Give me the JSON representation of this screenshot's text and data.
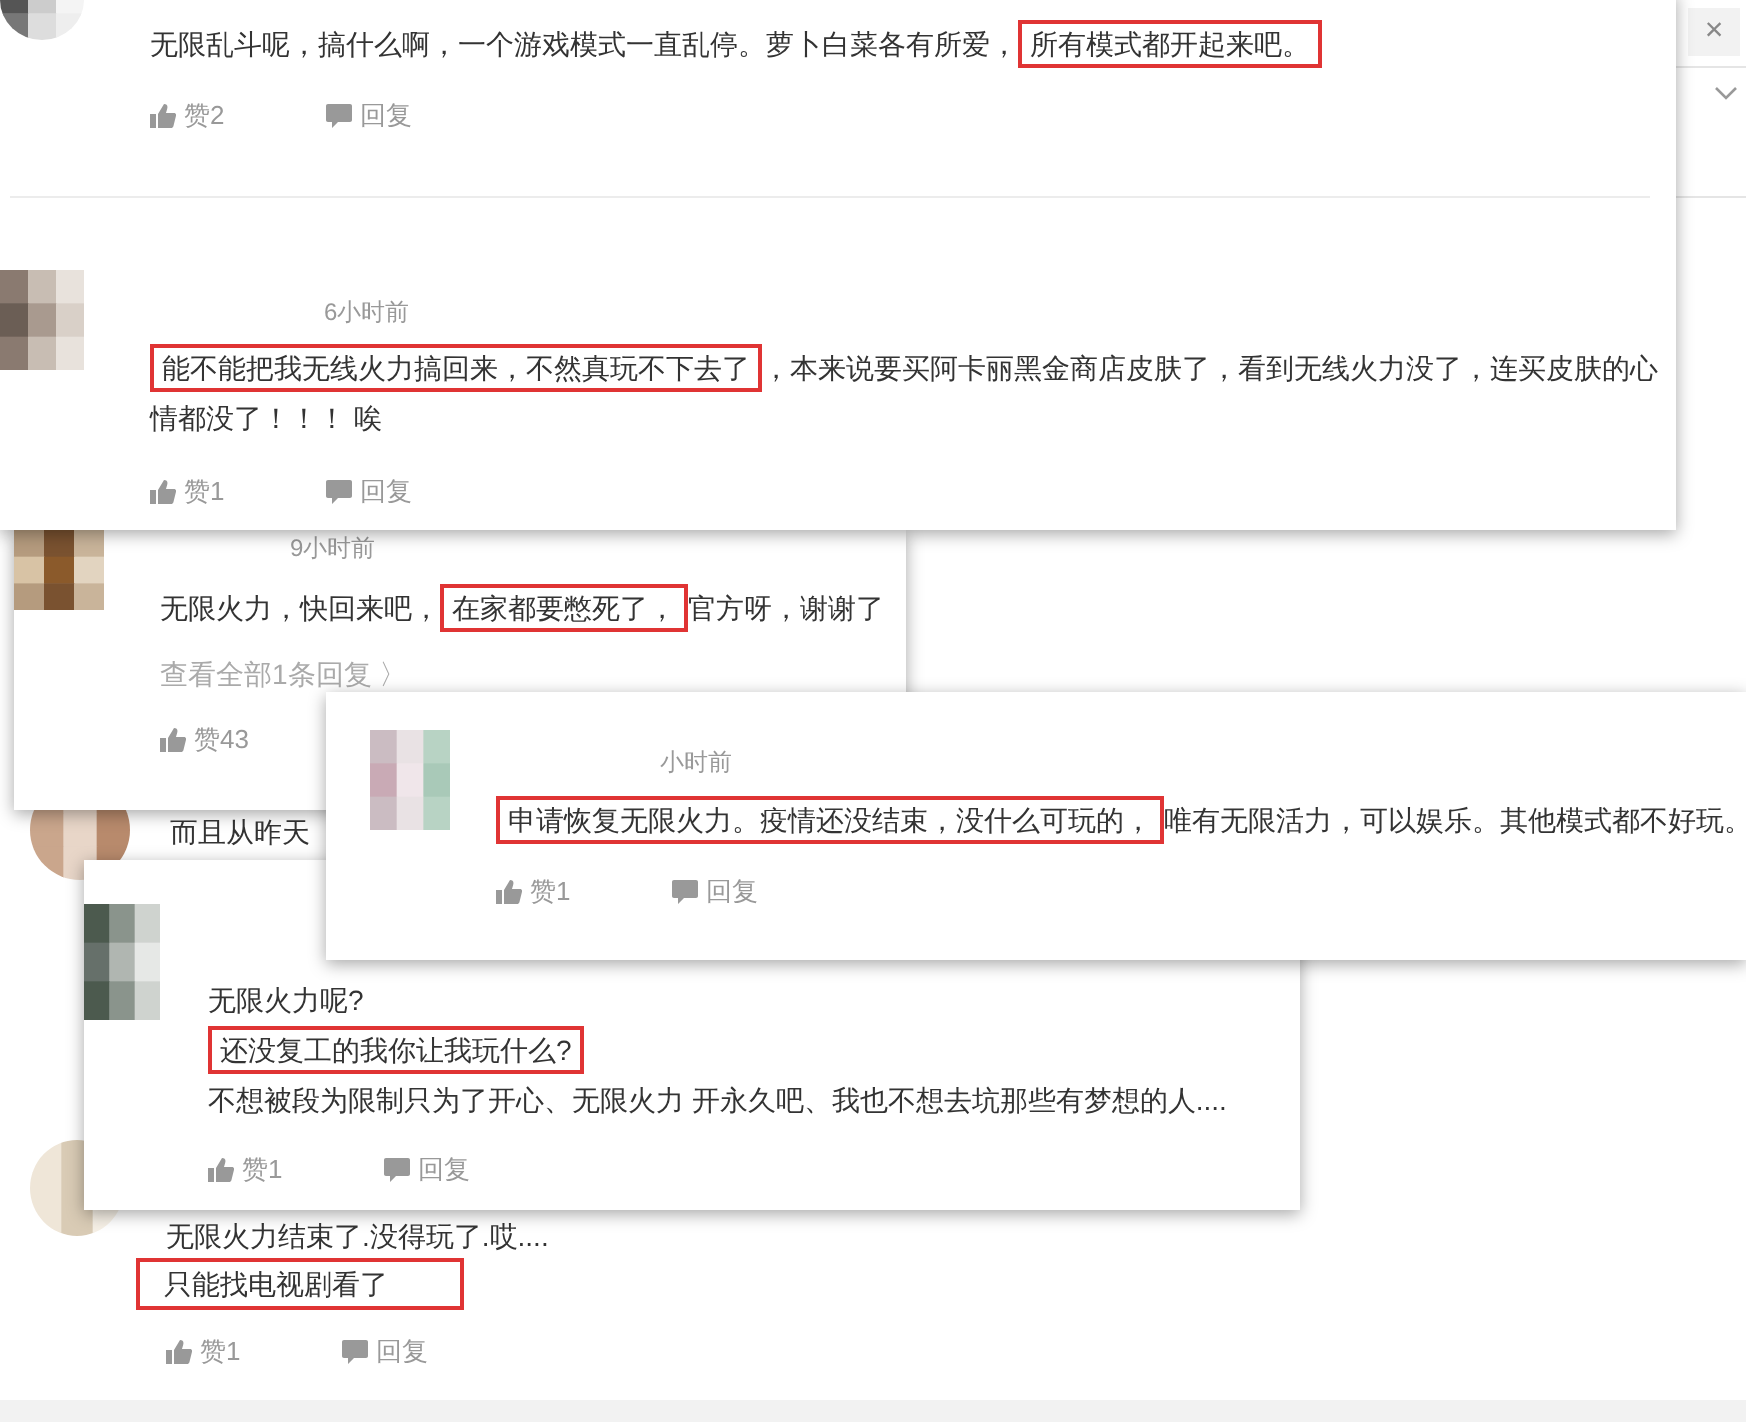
{
  "close_glyph": "×",
  "comments": [
    {
      "lines": [
        [
          {
            "text": "无限乱斗呢，搞什么啊，一个游戏模式一直乱停。萝卜白菜各有所爱，",
            "highlight": false
          },
          {
            "text": "所有模式都开起来吧。",
            "highlight": true
          }
        ]
      ],
      "likes": "赞2",
      "reply": "回复"
    },
    {
      "time": "6小时前",
      "lines": [
        [
          {
            "text": "能不能把我无线火力搞回来，不然真玩不下去了",
            "highlight": true
          },
          {
            "text": "，本来说要买阿卡丽黑金商店皮肤了，看到无线火力没了，连买皮肤的心",
            "highlight": false
          }
        ],
        [
          {
            "text": "情都没了！！！ 唉",
            "highlight": false
          }
        ]
      ],
      "likes": "赞1",
      "reply": "回复"
    },
    {
      "time": "9小时前",
      "lines": [
        [
          {
            "text": "无限火力，快回来吧，",
            "highlight": false
          },
          {
            "text": "在家都要憋死了，",
            "highlight": true
          },
          {
            "text": "官方呀，谢谢了",
            "highlight": false
          }
        ]
      ],
      "view_replies": "查看全部1条回复 〉",
      "likes": "赞43"
    },
    {
      "lines": [
        [
          {
            "text": "而且从昨天",
            "highlight": false
          }
        ]
      ]
    },
    {
      "time": "小时前",
      "lines": [
        [
          {
            "text": "申请恢复无限火力。疫情还没结束，没什么可玩的，",
            "highlight": true
          },
          {
            "text": "唯有无限活力，可以娱乐。其他模式都不好玩。",
            "highlight": false
          }
        ]
      ],
      "likes": "赞1",
      "reply": "回复"
    },
    {
      "lines": [
        [
          {
            "text": "无限火力呢?",
            "highlight": false
          }
        ],
        [
          {
            "text": "还没复工的我你让我玩什么?",
            "highlight": true
          }
        ],
        [
          {
            "text": "不想被段为限制只为了开心、无限火力 开永久吧、我也不想去坑那些有梦想的人....",
            "highlight": false
          }
        ]
      ],
      "likes": "赞1",
      "reply": "回复"
    },
    {
      "lines": [
        [
          {
            "text": "无限火力结束了.没得玩了.哎....",
            "highlight": false
          }
        ],
        [
          {
            "text": "只能找电视剧看了",
            "highlight": true
          }
        ]
      ],
      "likes": "赞1",
      "reply": "回复"
    }
  ]
}
